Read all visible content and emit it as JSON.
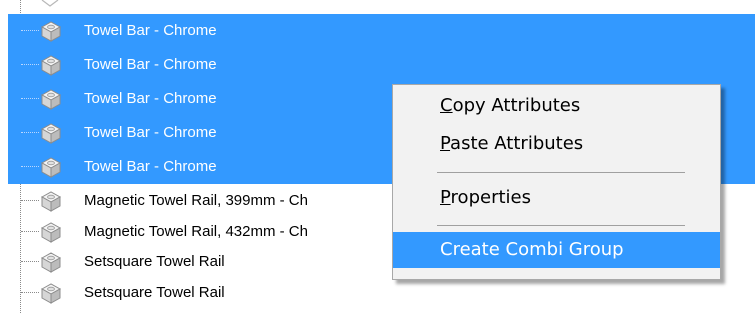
{
  "tree": {
    "items": [
      {
        "label": "Towel Bar - Chrome",
        "selected": true
      },
      {
        "label": "Towel Bar - Chrome",
        "selected": true
      },
      {
        "label": "Towel Bar - Chrome",
        "selected": true
      },
      {
        "label": "Towel Bar - Chrome",
        "selected": true
      },
      {
        "label": "Towel Bar - Chrome",
        "selected": true
      },
      {
        "label": "Magnetic Towel Rail, 399mm - Ch",
        "selected": false
      },
      {
        "label": "Magnetic Towel Rail, 432mm - Ch",
        "selected": false
      },
      {
        "label": "Setsquare Towel Rail",
        "selected": false
      },
      {
        "label": "Setsquare Towel Rail",
        "selected": false
      }
    ],
    "selection_color": "#3399ff",
    "node_icon": "component-block-icon"
  },
  "context_menu": {
    "items": [
      {
        "label": "Copy Attributes",
        "mnemonic": "C",
        "rest": "opy Attributes"
      },
      {
        "label": "Paste Attributes",
        "mnemonic": "P",
        "rest": "aste Attributes"
      },
      {
        "label": "Properties",
        "mnemonic": "P",
        "rest": "roperties"
      },
      {
        "label": "Create Combi Group",
        "highlighted": true
      }
    ],
    "highlight_color": "#3399ff"
  }
}
